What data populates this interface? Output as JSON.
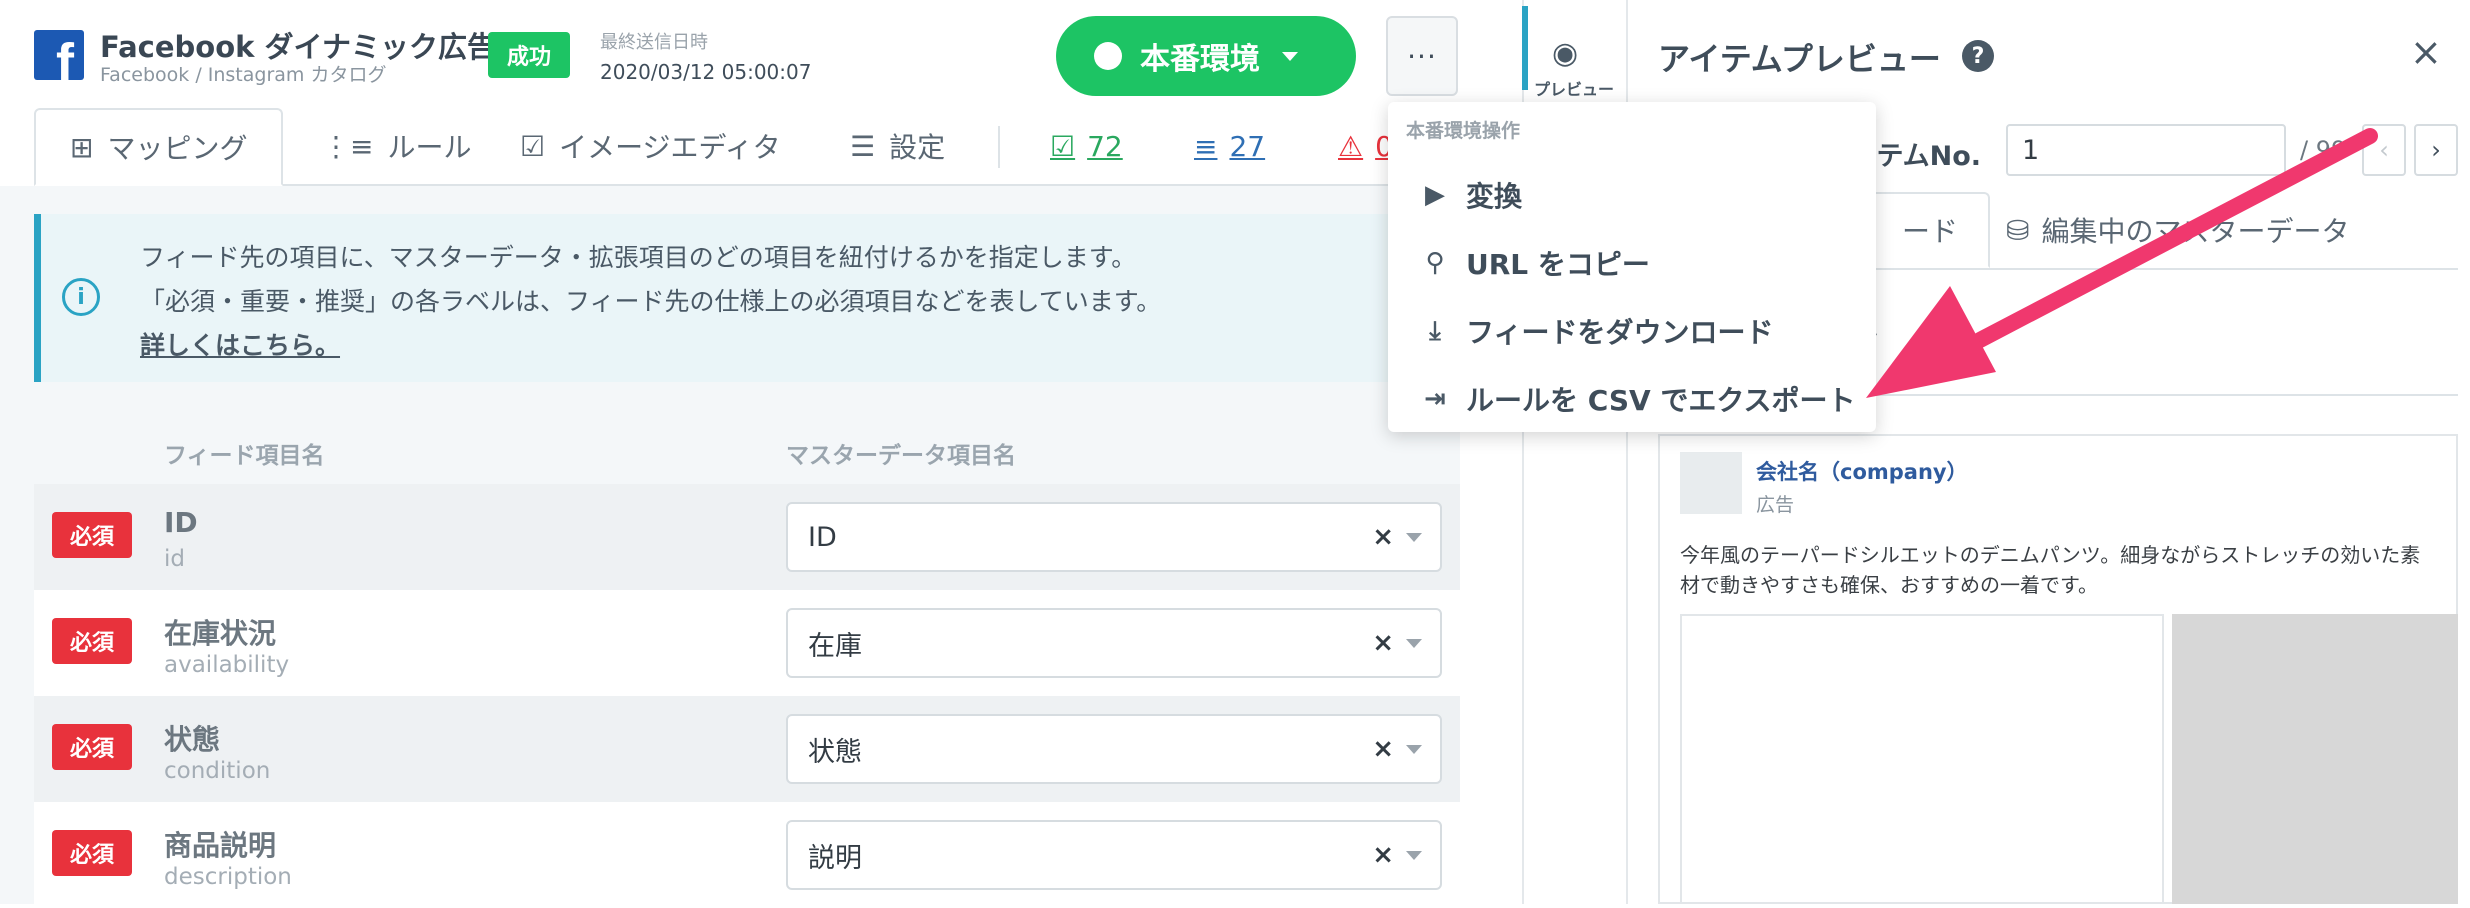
{
  "header": {
    "app_title": "Facebook ダイナミック広告",
    "app_subtitle": "Facebook / Instagram カタログ",
    "status_badge": "成功",
    "last_sent_label": "最終送信日時",
    "last_sent_value": "2020/03/12 05:00:07",
    "env_button_label": "本番環境",
    "more_button": "···"
  },
  "tabs": [
    {
      "label": "マッピング"
    },
    {
      "label": "ルール"
    },
    {
      "label": "イメージエディタ"
    },
    {
      "label": "設定"
    }
  ],
  "counts": {
    "valid": "72",
    "excluded": "27",
    "warning": "0"
  },
  "info": {
    "line1": "フィード先の項目に、マスターデータ・拡張項目のどの項目を紐付けるかを指定します。",
    "line2": "「必須・重要・推奨」の各ラベルは、フィード先の仕様上の必須項目などを表しています。",
    "link": "詳しくはこちら。"
  },
  "table": {
    "col_feed": "フィード項目名",
    "col_master": "マスターデータ項目名",
    "rows": [
      {
        "badge": "必須",
        "name": "ID",
        "key": "id",
        "value": "ID"
      },
      {
        "badge": "必須",
        "name": "在庫状況",
        "key": "availability",
        "value": "在庫"
      },
      {
        "badge": "必須",
        "name": "状態",
        "key": "condition",
        "value": "状態"
      },
      {
        "badge": "必須",
        "name": "商品説明",
        "key": "description",
        "value": "説明"
      }
    ]
  },
  "menu": {
    "header": "本番環境操作",
    "items": [
      {
        "label": "変換",
        "icon": "play-icon"
      },
      {
        "label": "URL をコピー",
        "icon": "link-icon"
      },
      {
        "label": "フィードをダウンロード",
        "icon": "download-icon"
      },
      {
        "label": "ルールを CSV でエクスポート",
        "icon": "export-icon"
      }
    ]
  },
  "side": {
    "preview_label": "プレビュー"
  },
  "preview": {
    "title": "アイテムプレビュー",
    "item_label": "イテムNo.",
    "item_value": "1",
    "item_total": "/ 99",
    "tab_feed": "ード",
    "tab_master": "編集中のマスターデータ",
    "company": "会社名（company）",
    "ad_label": "広告",
    "ad_text": "今年風のテーパードシルエットのデニムパンツ。細身ながらストレッチの効いた素材で動きやすさも確保、おすすめの一着です。"
  },
  "colors": {
    "accent_green": "#1dc464",
    "danger_red": "#e8323c",
    "info_blue": "#2aa3c4",
    "arrow_pink": "#f0386e"
  }
}
